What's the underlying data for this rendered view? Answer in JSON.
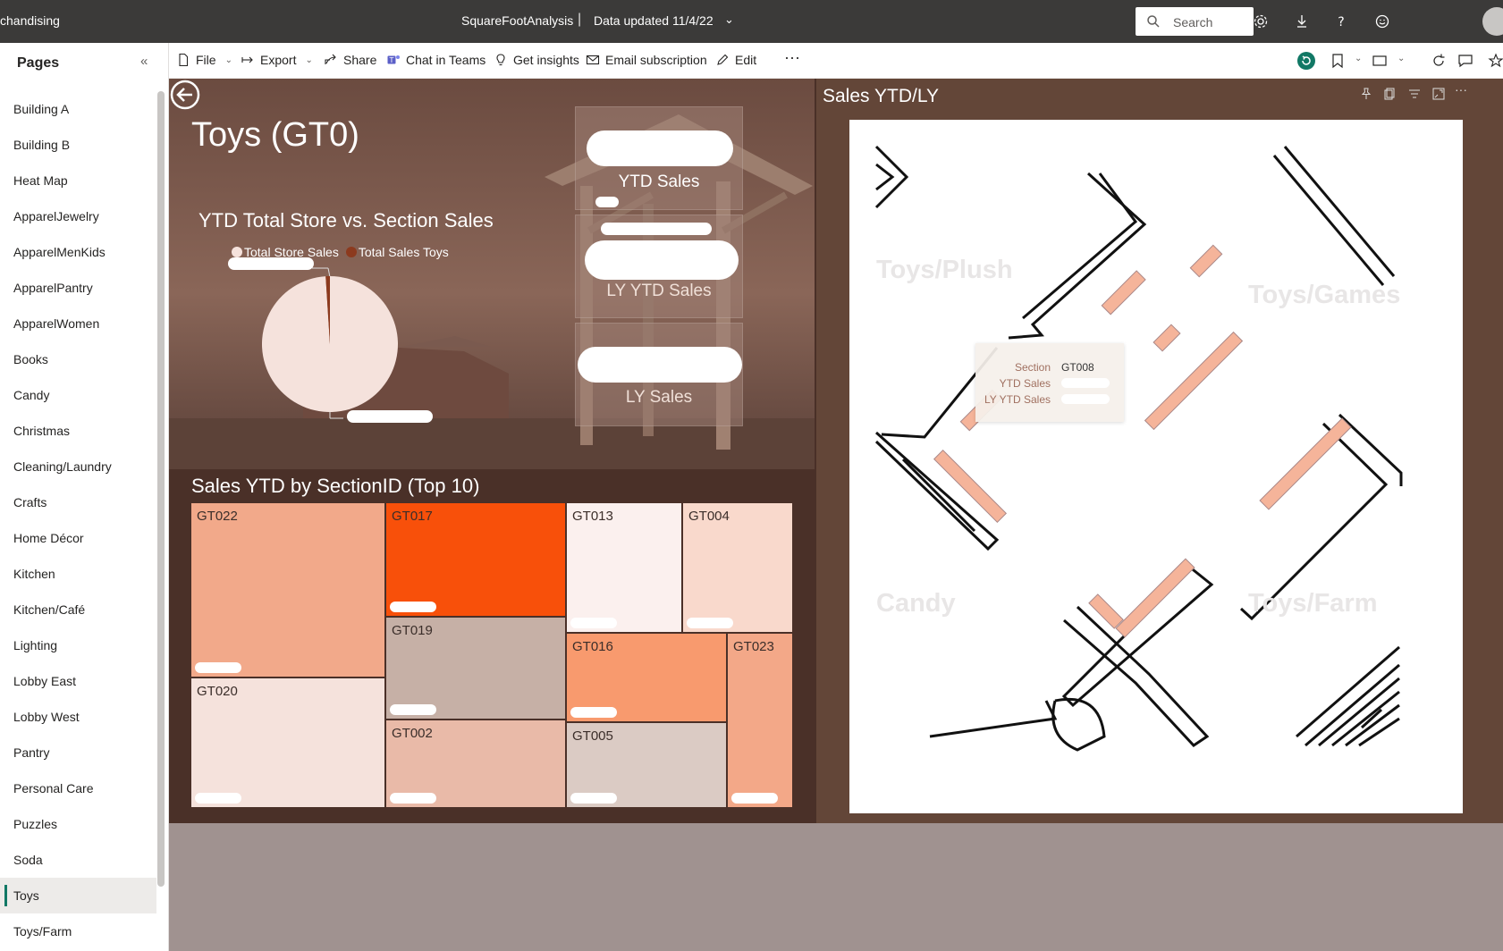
{
  "topbar": {
    "app_name": "chandising",
    "report_title": "SquareFootAnalysis",
    "separator": "|",
    "data_updated": "Data updated 11/4/22",
    "search_placeholder": "Search"
  },
  "actionbar": {
    "file": "File",
    "export": "Export",
    "share": "Share",
    "chat": "Chat in Teams",
    "insights": "Get insights",
    "email": "Email subscription",
    "edit": "Edit",
    "more": "···"
  },
  "pages": {
    "title": "Pages",
    "items": [
      "Building A",
      "Building B",
      "Heat Map",
      "ApparelJewelry",
      "ApparelMenKids",
      "ApparelPantry",
      "ApparelWomen",
      "Books",
      "Candy",
      "Christmas",
      "Cleaning/Laundry",
      "Crafts",
      "Home Décor",
      "Kitchen",
      "Kitchen/Café",
      "Lighting",
      "Lobby East",
      "Lobby West",
      "Pantry",
      "Personal Care",
      "Puzzles",
      "Soda",
      "Toys",
      "Toys/Farm"
    ],
    "active": "Toys"
  },
  "report": {
    "page_title": "Toys (GT0)",
    "pie_title": "YTD Total Store vs. Section Sales",
    "legend": [
      "Total Store Sales",
      "Total Sales Toys"
    ],
    "cards": [
      "YTD Sales",
      "LY YTD Sales",
      "LY Sales"
    ],
    "treemap_title": "Sales YTD by SectionID (Top 10)",
    "treemap": [
      {
        "id": "GT022",
        "color": "#f2a98a"
      },
      {
        "id": "GT020",
        "color": "#f5e2dc"
      },
      {
        "id": "GT017",
        "color": "#f8500a"
      },
      {
        "id": "GT019",
        "color": "#c6b0a6"
      },
      {
        "id": "GT002",
        "color": "#e9baa8"
      },
      {
        "id": "GT013",
        "color": "#fbf0ee"
      },
      {
        "id": "GT004",
        "color": "#f9d9cc"
      },
      {
        "id": "GT016",
        "color": "#f89a6e"
      },
      {
        "id": "GT023",
        "color": "#f3a888"
      },
      {
        "id": "GT005",
        "color": "#dbcbc4"
      }
    ]
  },
  "visual": {
    "title": "Sales YTD/LY",
    "zones": [
      "Toys/Plush",
      "Toys/Games",
      "Candy",
      "Toys/Farm"
    ],
    "tooltip": {
      "section_label": "Section",
      "section_value": "GT008",
      "ytd_label": "YTD Sales",
      "ly_label": "LY YTD Sales"
    }
  },
  "colors": {
    "topbar": "#3b3a39",
    "accent": "#117865",
    "report_bg": "#4a3028",
    "visual_bg": "#634638",
    "store_sales": "#f5e2dc",
    "toys_sales": "#8c3a1e"
  },
  "chart_data": {
    "type": "pie",
    "title": "YTD Total Store vs. Section Sales",
    "series": [
      {
        "name": "Total Store Sales",
        "share": 0.99
      },
      {
        "name": "Total Sales Toys",
        "share": 0.01
      }
    ]
  }
}
